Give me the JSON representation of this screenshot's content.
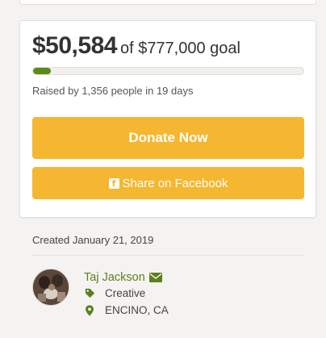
{
  "campaign": {
    "raised_amount": "$50,584",
    "goal_text": "of $777,000 goal",
    "progress_fraction": 0.065,
    "stats_text": "Raised by 1,356 people in 19 days"
  },
  "actions": {
    "donate_label": "Donate Now",
    "share_label": "Share on Facebook"
  },
  "created_text": "Created January 21, 2019",
  "organizer": {
    "name": "Taj Jackson",
    "category": "Creative",
    "location": "ENCINO, CA"
  },
  "colors": {
    "button": "#f5b731",
    "progress": "#5a8a1a",
    "link": "#5e7f1d"
  },
  "icons": {
    "facebook": "facebook-icon",
    "mail": "envelope-icon",
    "tag": "tag-icon",
    "location": "map-marker-icon"
  }
}
